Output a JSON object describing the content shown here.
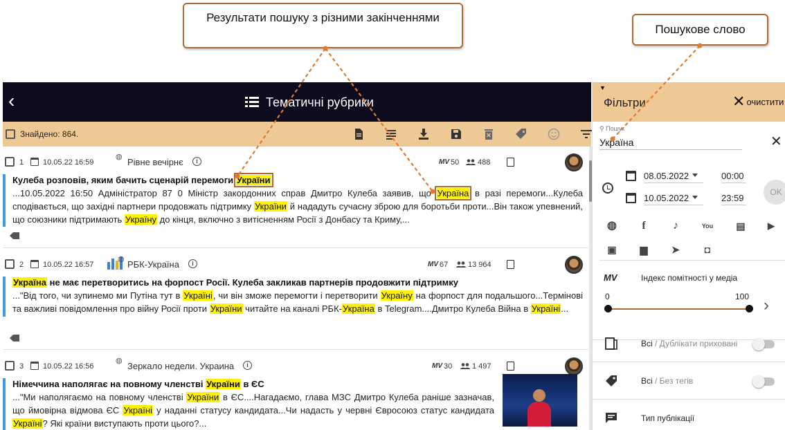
{
  "callouts": {
    "left": "Результати пошуку  з різними закінченнями",
    "right": "Пошукове слово"
  },
  "header": {
    "title": "Тематичні рубрики"
  },
  "found": {
    "text": "Знайдено: 864."
  },
  "toolbar": [
    "document-icon",
    "text-lines-icon",
    "download-icon",
    "save-icon",
    "delete-icon",
    "tag-icon",
    "smiley-icon",
    "filter-sort-icon"
  ],
  "articles": [
    {
      "num": "1",
      "date": "10.05.22 16:59",
      "source": "Рівне вечірнє",
      "mv_label": "MV",
      "mv": "50",
      "audience": "488",
      "title_before": "Кулеба розповів, яким бачить сценарій перемоги ",
      "title_mark": "України",
      "title_after": "",
      "snip1": "...10.05.2022 16:50 Адміністратор 87 0 Міністр закордонних справ Дмитро Кулеба заявив, що ",
      "snip1_mark": "Україна",
      "snip2": " в разі перемоги...Кулеба сподівається, що західні партнери продовжать підтримку ",
      "snip2_mark": "України",
      "snip3": " й нададуть сучасну зброю для боротьби проти...Він також упевнений, що союзники підтримають ",
      "snip3_mark": "Україну",
      "snip4": " до кінця, включно з витісненням Росії з Донбасу та Криму,..."
    },
    {
      "num": "2",
      "date": "10.05.22 16:57",
      "source": "РБК-Україна",
      "mv_label": "MV",
      "mv": "67",
      "audience": "13 964",
      "title_mark": "Україна",
      "title_after": " не має перетворитись на форпост Росії. Кулеба закликав партнерів продовжити підтримку",
      "snip1": "...\"Від того, чи зупинемо ми Путіна тут в ",
      "snip1_mark": "Україні",
      "snip2": ", чи він зможе перемогти і перетворити ",
      "snip2_mark": "Україну",
      "snip3": " на форпост для подальшого...Термінові та важливі повідомлення про війну Росії проти ",
      "snip3_mark": "України",
      "snip4": " читайте на каналі РБК-",
      "snip4_mark": "Україна",
      "snip5": " в Telegram....Дмитро Кулеба Війна в ",
      "snip5_mark": "Україні",
      "snip6": "..."
    },
    {
      "num": "3",
      "date": "10.05.22 16:56",
      "source": "Зеркало недели. Украина",
      "mv_label": "MV",
      "mv": "30",
      "audience": "1 497",
      "title_before": "Німеччина наполягає на повному членстві ",
      "title_mark": "України",
      "title_after": " в ЄС",
      "snip1": "...\"Ми наполягаємо на повному членстві ",
      "snip1_mark": "України",
      "snip2": " в ЄС....Нагадаємо, глава МЗС Дмитро Кулеба раніше зазначав, що ймовірна відмова ЄС ",
      "snip2_mark": "Україні",
      "snip3": " у наданні статусу кандидата...Чи надасть у червні Євросоюз статус кандидата ",
      "snip3_mark": "Україні",
      "snip4": "? Які країни виступають проти цього?..."
    }
  ],
  "filters": {
    "title": "Фільтри",
    "clear_label": "очистити",
    "search_label": "Пошук",
    "search_value": "Україна",
    "date_from": "08.05.2022",
    "time_from": "00:00",
    "date_to": "10.05.2022",
    "time_to": "23:59",
    "ok_label": "OK",
    "mv_label": "MV",
    "mv_title": "Індекс помітності у медіа",
    "mv_min": "0",
    "mv_max": "100",
    "slider_min_fraction": 0.0,
    "slider_max_fraction": 1.0,
    "dup_all": "Всі",
    "dup_sub": " / Дублікати приховані",
    "tags_all": "Всі",
    "tags_sub": " / Без тегів",
    "pub_type": "Тип публікації"
  },
  "social": [
    "globe-icon",
    "facebook-icon",
    "twitter-icon",
    "youtube-icon",
    "news-icon",
    "video-icon",
    "radio-icon",
    "forum-icon",
    "telegram-icon",
    "instagram-icon"
  ]
}
